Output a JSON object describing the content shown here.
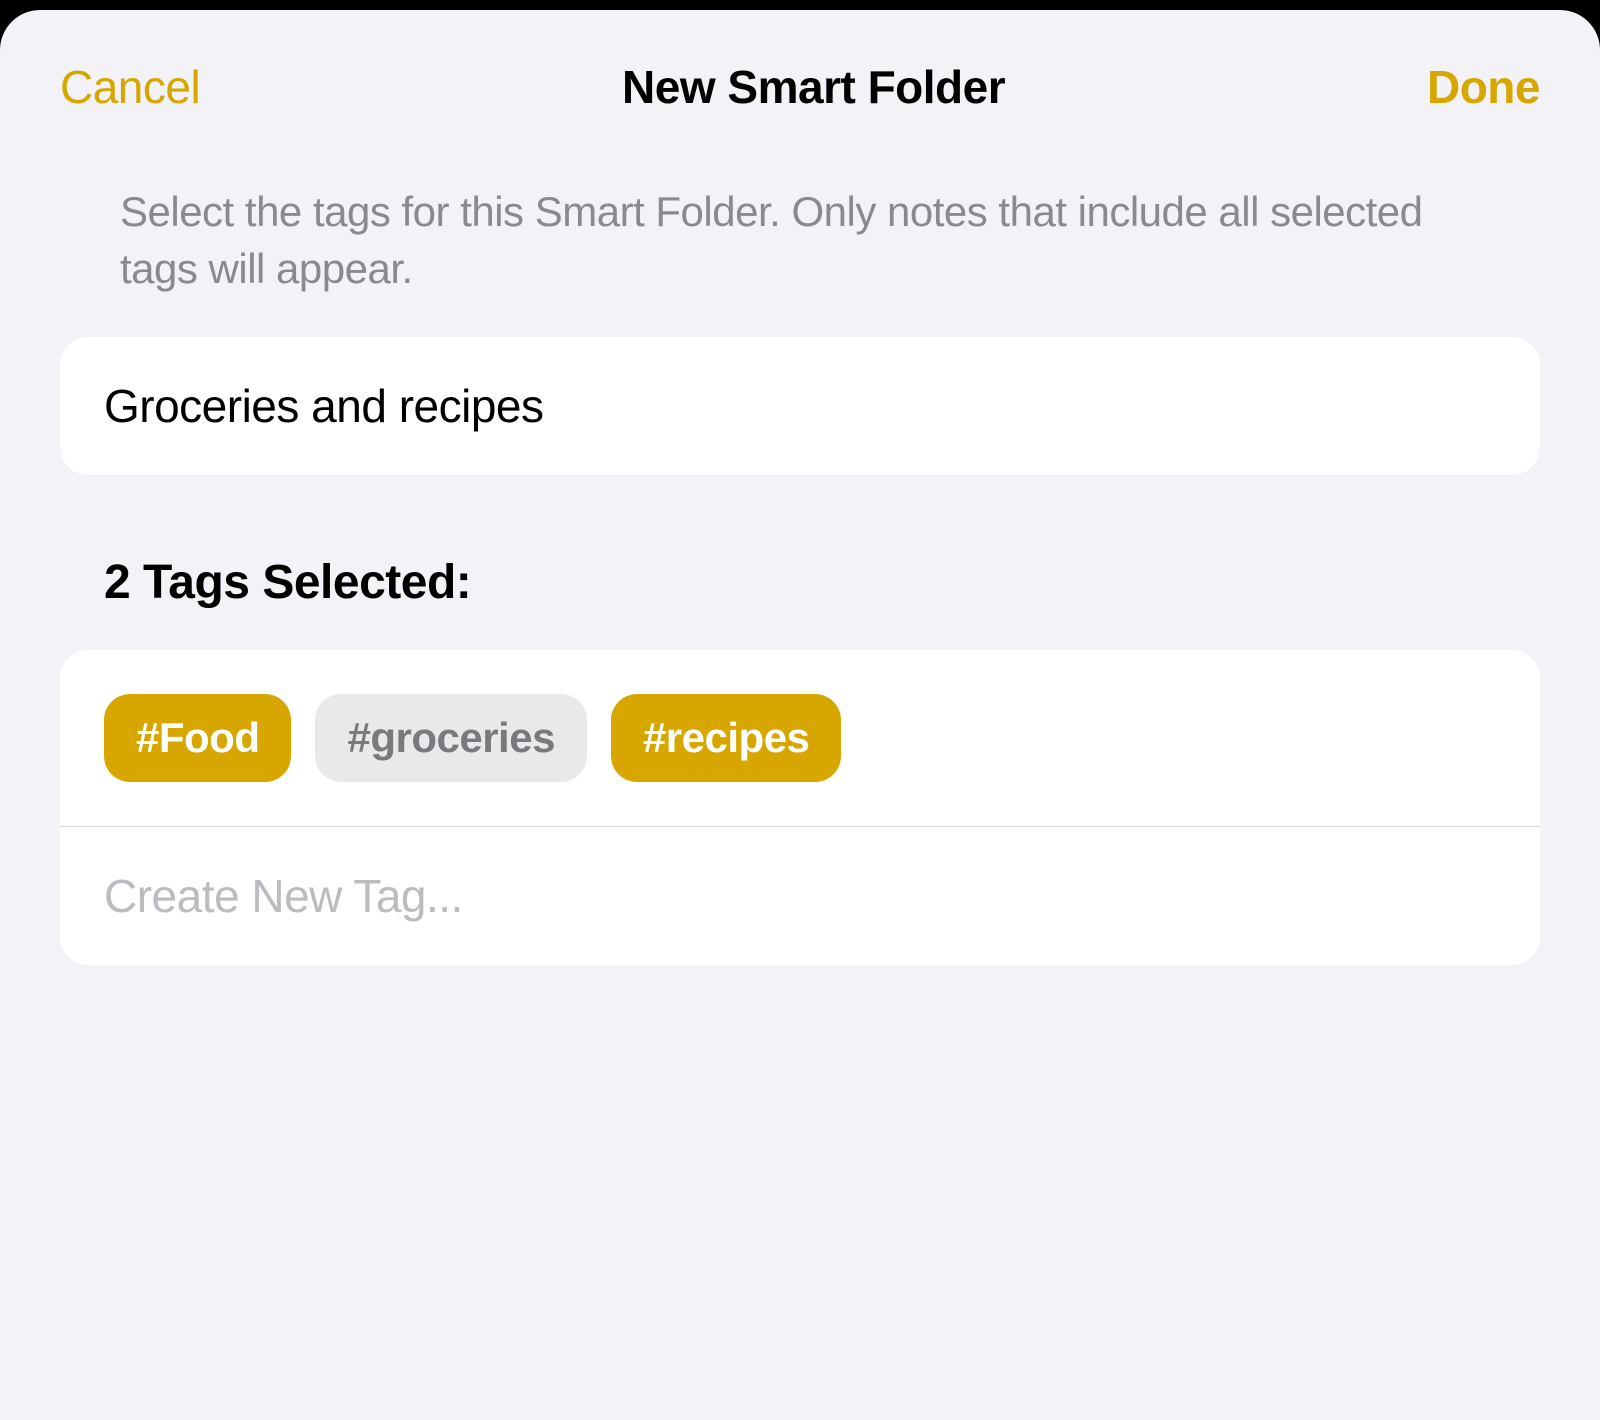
{
  "navbar": {
    "cancel": "Cancel",
    "title": "New Smart Folder",
    "done": "Done"
  },
  "description": "Select the tags for this Smart Folder. Only notes that include all selected tags will appear.",
  "folder_name": "Groceries and recipes",
  "tags_heading": "2 Tags Selected:",
  "tags": [
    {
      "label": "#Food",
      "selected": true
    },
    {
      "label": "#groceries",
      "selected": false
    },
    {
      "label": "#recipes",
      "selected": true
    }
  ],
  "create_tag_placeholder": "Create New Tag...",
  "colors": {
    "accent": "#d7a700",
    "sheet_bg": "#f2f2f7",
    "card_bg": "#ffffff",
    "text_secondary": "#8a8a8e",
    "chip_unselected_bg": "#e9e9eb",
    "chip_unselected_text": "#7a7a7e"
  }
}
